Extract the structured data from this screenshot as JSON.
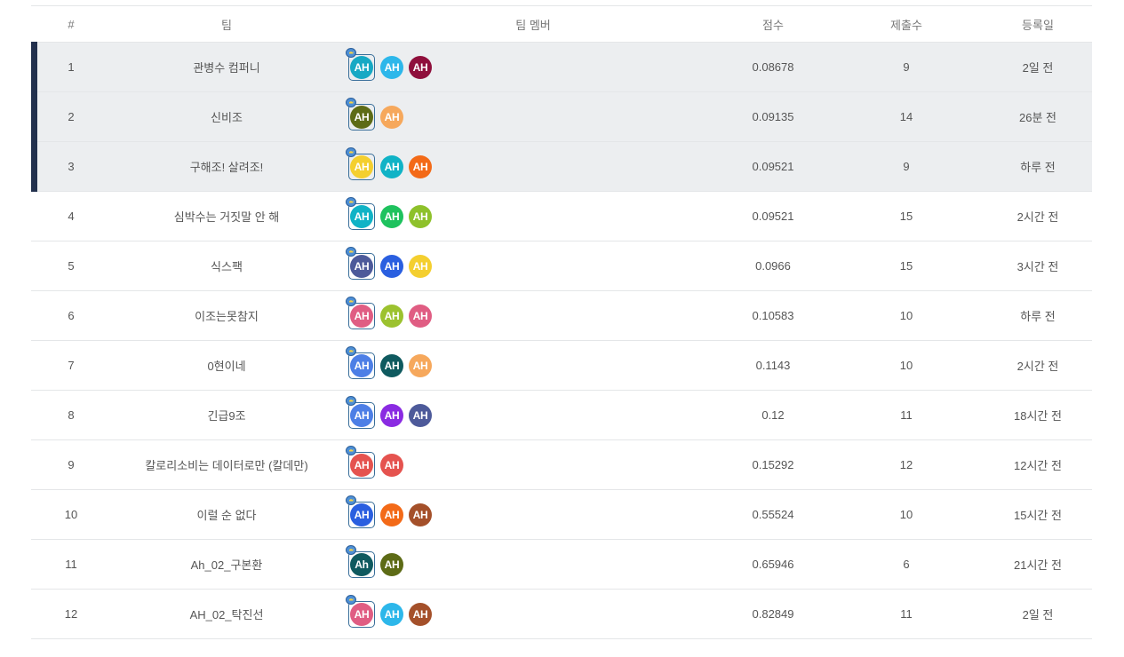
{
  "headers": {
    "rank": "#",
    "team": "팀",
    "members": "팀 멤버",
    "score": "점수",
    "submissions": "제출수",
    "registered": "등록일"
  },
  "rows": [
    {
      "rank": "1",
      "team": "관병수 컴퍼니",
      "score": "0.08678",
      "submissions": "9",
      "registered": "2일 전",
      "highlight": true,
      "members": [
        {
          "label": "AH",
          "color": "#17a9c4"
        },
        {
          "label": "AH",
          "color": "#2db7ea"
        },
        {
          "label": "AH",
          "color": "#8f0f3c"
        }
      ]
    },
    {
      "rank": "2",
      "team": "신비조",
      "score": "0.09135",
      "submissions": "14",
      "registered": "26분 전",
      "highlight": true,
      "members": [
        {
          "label": "AH",
          "color": "#5d6b16"
        },
        {
          "label": "AH",
          "color": "#f6a85c"
        }
      ]
    },
    {
      "rank": "3",
      "team": "구해조! 살려조!",
      "score": "0.09521",
      "submissions": "9",
      "registered": "하루 전",
      "highlight": true,
      "members": [
        {
          "label": "AH",
          "color": "#f4cf2f"
        },
        {
          "label": "AH",
          "color": "#10b3c6"
        },
        {
          "label": "AH",
          "color": "#f36a18"
        }
      ]
    },
    {
      "rank": "4",
      "team": "심박수는 거짓말 안 해",
      "score": "0.09521",
      "submissions": "15",
      "registered": "2시간 전",
      "highlight": false,
      "members": [
        {
          "label": "AH",
          "color": "#10b3c6"
        },
        {
          "label": "AH",
          "color": "#1ec25e"
        },
        {
          "label": "AH",
          "color": "#8ec12b"
        }
      ]
    },
    {
      "rank": "5",
      "team": "식스팩",
      "score": "0.0966",
      "submissions": "15",
      "registered": "3시간 전",
      "highlight": false,
      "members": [
        {
          "label": "AH",
          "color": "#4d5a9a"
        },
        {
          "label": "AH",
          "color": "#2a5fe0"
        },
        {
          "label": "AH",
          "color": "#f4cf2f"
        }
      ]
    },
    {
      "rank": "6",
      "team": "이조는못참지",
      "score": "0.10583",
      "submissions": "10",
      "registered": "하루 전",
      "highlight": false,
      "members": [
        {
          "label": "AH",
          "color": "#e05d83"
        },
        {
          "label": "AH",
          "color": "#9cc22f"
        },
        {
          "label": "AH",
          "color": "#e05d83"
        }
      ]
    },
    {
      "rank": "7",
      "team": "0현이네",
      "score": "0.1143",
      "submissions": "10",
      "registered": "2시간 전",
      "highlight": false,
      "members": [
        {
          "label": "AH",
          "color": "#4d7fe6"
        },
        {
          "label": "AH",
          "color": "#0f5a5f"
        },
        {
          "label": "AH",
          "color": "#f6a85c"
        }
      ]
    },
    {
      "rank": "8",
      "team": "긴급9조",
      "score": "0.12",
      "submissions": "11",
      "registered": "18시간 전",
      "highlight": false,
      "members": [
        {
          "label": "AH",
          "color": "#4d7fe6"
        },
        {
          "label": "AH",
          "color": "#8a2be2"
        },
        {
          "label": "AH",
          "color": "#4d5a9a"
        }
      ]
    },
    {
      "rank": "9",
      "team": "칼로리소비는 데이터로만 (칼데만)",
      "score": "0.15292",
      "submissions": "12",
      "registered": "12시간 전",
      "highlight": false,
      "members": [
        {
          "label": "AH",
          "color": "#e5534f"
        },
        {
          "label": "AH",
          "color": "#e5534f"
        }
      ]
    },
    {
      "rank": "10",
      "team": "이럴 순 없다",
      "score": "0.55524",
      "submissions": "10",
      "registered": "15시간 전",
      "highlight": false,
      "members": [
        {
          "label": "AH",
          "color": "#2a5fe0"
        },
        {
          "label": "AH",
          "color": "#f36a18"
        },
        {
          "label": "AH",
          "color": "#a4502a"
        }
      ]
    },
    {
      "rank": "11",
      "team": "Ah_02_구본환",
      "score": "0.65946",
      "submissions": "6",
      "registered": "21시간 전",
      "highlight": false,
      "members": [
        {
          "label": "Ah",
          "color": "#0f5a5f"
        },
        {
          "label": "AH",
          "color": "#5d6b16"
        }
      ]
    },
    {
      "rank": "12",
      "team": "AH_02_탁진선",
      "score": "0.82849",
      "submissions": "11",
      "registered": "2일 전",
      "highlight": false,
      "members": [
        {
          "label": "AH",
          "color": "#e05d83"
        },
        {
          "label": "AH",
          "color": "#2db7ea"
        },
        {
          "label": "AH",
          "color": "#a4502a"
        }
      ]
    }
  ]
}
